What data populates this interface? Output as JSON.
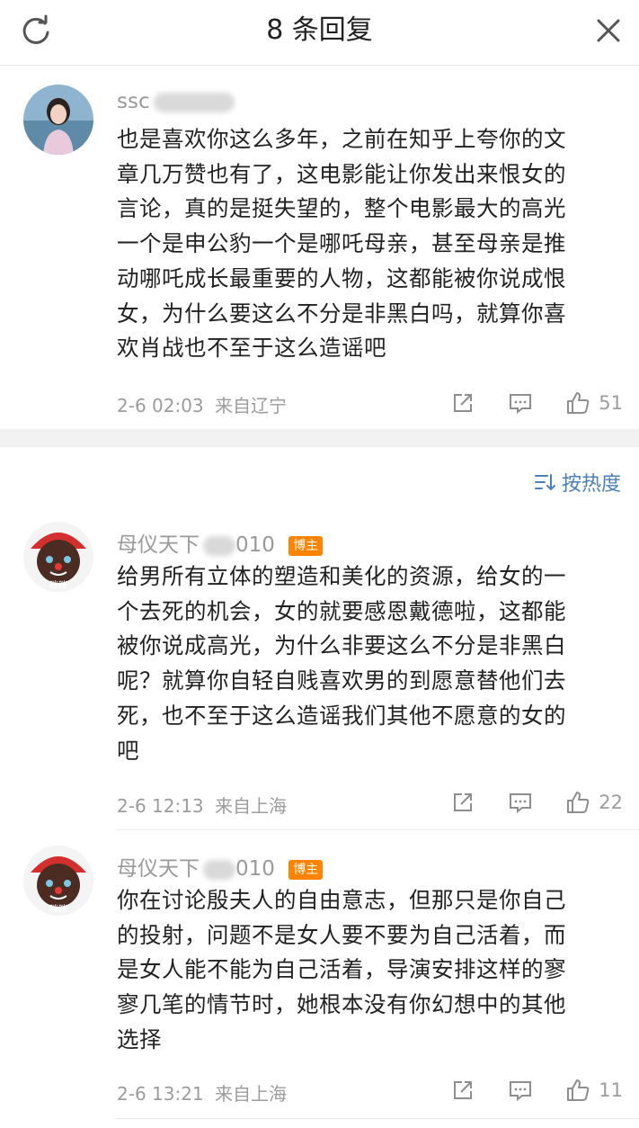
{
  "header": {
    "title": "8 条回复",
    "refresh_icon": "refresh-icon",
    "close_icon": "close-icon"
  },
  "sort": {
    "label": "按热度",
    "icon": "sort-icon",
    "color": "#4a7fb8"
  },
  "comments": [
    {
      "username": "ssc",
      "badge": "",
      "lines": [
        "也是喜欢你这么多年，之前在知乎上夸你的文",
        "章几万赞也有了，这电影能让你发出来恨女的",
        "言论，真的是挺失望的，整个电影最大的高光",
        "一个是申公豹一个是哪吒母亲，甚至母亲是推",
        "动哪吒成长最重要的人物，这都能被你说成恨",
        "女，为什么要这么不分是非黑白吗，就算你喜",
        "欢肖战也不至于这么造谣吧"
      ],
      "time": "2-6 02:03",
      "location": "来自辽宁",
      "likes": "51"
    },
    {
      "username": "母仪天下",
      "username_suffix": "010",
      "badge": "博主",
      "avatar_text": "眯眯",
      "lines": [
        "给男所有立体的塑造和美化的资源，给女的一",
        "个去死的机会，女的就要感恩戴德啦，这都能",
        "被你说成高光，为什么非要这么不分是非黑白",
        "呢？就算你自轻自贱喜欢男的到愿意替他们去",
        "死，也不至于这么造谣我们其他不愿意的女的",
        "吧"
      ],
      "time": "2-6 12:13",
      "location": "来自上海",
      "likes": "22"
    },
    {
      "username": "母仪天下",
      "username_suffix": "010",
      "badge": "博主",
      "avatar_text": "眯眯",
      "lines": [
        "你在讨论殷夫人的自由意志，但那只是你自己",
        "的投射，问题不是女人要不要为自己活着，而",
        "是女人能不能为自己活着，导演安排这样的寥",
        "寥几笔的情节时，她根本没有你幻想中的其他",
        "选择"
      ],
      "time": "2-6 13:21",
      "location": "来自上海",
      "likes": "11"
    }
  ],
  "action_icons": [
    "share-icon",
    "comment-icon",
    "like-icon"
  ],
  "colors": {
    "badge": "#ff8200",
    "meta": "#9c9c9c",
    "separator": "#f2f2f2"
  }
}
